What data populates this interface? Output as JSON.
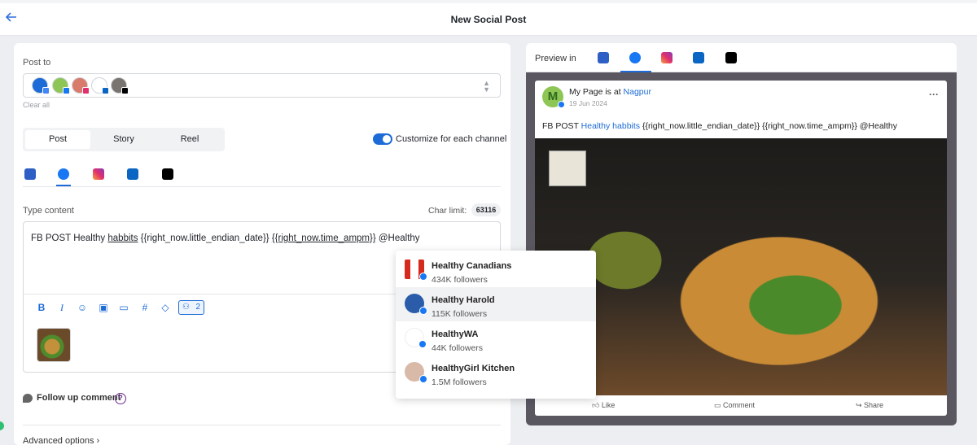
{
  "header": {
    "title": "New Social Post"
  },
  "left": {
    "post_to_label": "Post to",
    "clear_all": "Clear all",
    "tabs": [
      "Post",
      "Story",
      "Reel"
    ],
    "customize_label": "Customize for each channel",
    "type_content_label": "Type content",
    "char_limit_label": "Char limit:",
    "char_limit_value": "63116",
    "content": {
      "prefix": "FB POST Healthy ",
      "underlined": "habbits",
      "mid": "  {{right_now.little_endian_date}} ",
      "token2": "{{right_now.time_ampm}}",
      "suffix": " @Healthy"
    },
    "mention_count": "2",
    "follow_up": "Follow up comment",
    "help": "?",
    "advanced": "Advanced options"
  },
  "mentions": [
    {
      "name": "Healthy Canadians",
      "followers": "434K followers"
    },
    {
      "name": "Healthy Harold",
      "followers": "115K followers"
    },
    {
      "name": "HealthyWA",
      "followers": "44K followers"
    },
    {
      "name": "HealthyGirl Kitchen",
      "followers": "1.5M followers"
    }
  ],
  "preview": {
    "label": "Preview in",
    "page_text": "My Page is at ",
    "location": "Nagpur",
    "date": "19 Jun 2024",
    "avatar_letter": "M",
    "post_prefix": "FB POST ",
    "post_link": "Healthy habbits",
    "post_rest": "  {{right_now.little_endian_date}} {{right_now.time_ampm}} @Healthy",
    "actions": [
      "Like",
      "Comment",
      "Share"
    ],
    "more": "···"
  },
  "colors": {
    "accent": "#1c6bd6",
    "facebook": "#1877f2",
    "preview_bg": "#5a5761"
  }
}
